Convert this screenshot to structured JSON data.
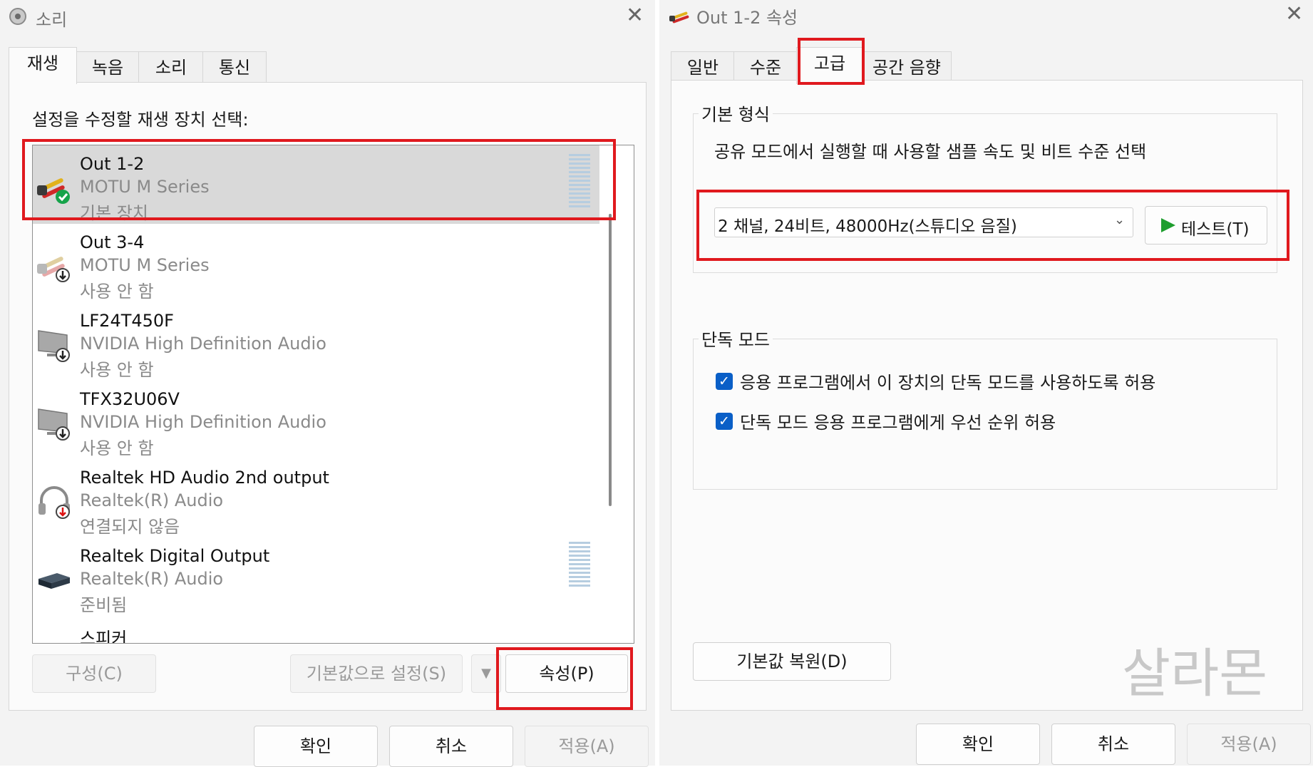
{
  "sound_window": {
    "title": "소리",
    "tabs": [
      "재생",
      "녹음",
      "소리",
      "통신"
    ],
    "instruction": "설정을 수정할 재생 장치 선택:",
    "devices": [
      {
        "name": "Out 1-2",
        "driver": "MOTU M Series",
        "status": "기본 장치"
      },
      {
        "name": "Out 3-4",
        "driver": "MOTU M Series",
        "status": "사용 안 함"
      },
      {
        "name": "LF24T450F",
        "driver": "NVIDIA High Definition Audio",
        "status": "사용 안 함"
      },
      {
        "name": "TFX32U06V",
        "driver": "NVIDIA High Definition Audio",
        "status": "사용 안 함"
      },
      {
        "name": "Realtek HD Audio 2nd output",
        "driver": "Realtek(R) Audio",
        "status": "연결되지 않음"
      },
      {
        "name": "Realtek Digital Output",
        "driver": "Realtek(R) Audio",
        "status": "준비됨"
      },
      {
        "name": "스피커",
        "driver": "",
        "status": ""
      }
    ],
    "buttons": {
      "configure": "구성(C)",
      "set_default": "기본값으로 설정(S)",
      "properties": "속성(P)",
      "ok": "확인",
      "cancel": "취소",
      "apply": "적용(A)"
    }
  },
  "props_window": {
    "title": "Out 1-2 속성",
    "tabs": [
      "일반",
      "수준",
      "고급",
      "공간 음향"
    ],
    "default_format": {
      "group_label": "기본 형식",
      "description": "공유 모드에서 실행할 때 사용할 샘플 속도 및 비트 수준 선택",
      "selected_format": "2 채널, 24비트, 48000Hz(스튜디오 음질)",
      "test_button": "테스트(T)"
    },
    "exclusive_mode": {
      "group_label": "단독 모드",
      "options": [
        {
          "label": "응용 프로그램에서 이 장치의 단독 모드를 사용하도록 허용",
          "checked": true
        },
        {
          "label": "단독 모드 응용 프로그램에게 우선 순위 허용",
          "checked": true
        }
      ]
    },
    "restore_defaults": "기본값 복원(D)",
    "watermark": "살라몬",
    "buttons": {
      "ok": "확인",
      "cancel": "취소",
      "apply": "적용(A)"
    }
  },
  "colors": {
    "highlight": "#e0191e",
    "checkbox": "#0a5fc7",
    "play": "#1e9e2e"
  }
}
